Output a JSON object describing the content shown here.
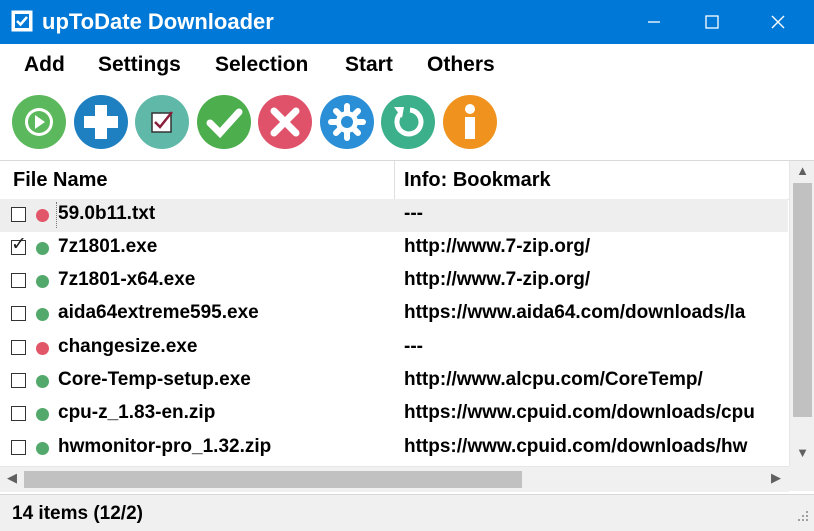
{
  "window": {
    "title": "upToDate Downloader"
  },
  "menu": [
    "Add",
    "Settings",
    "Selection",
    "Start",
    "Others"
  ],
  "toolbar": {
    "buttons": [
      {
        "icon": "play-icon",
        "color": "#5cb85c"
      },
      {
        "icon": "plus-icon",
        "color": "#1e7fc1"
      },
      {
        "icon": "checkbox-icon",
        "color": "#5fb8a8"
      },
      {
        "icon": "checkmark-icon",
        "color": "#4cae4c"
      },
      {
        "icon": "cross-icon",
        "color": "#e0526a"
      },
      {
        "icon": "gear-icon",
        "color": "#2a8fd6"
      },
      {
        "icon": "refresh-icon",
        "color": "#3bb08a"
      },
      {
        "icon": "info-icon",
        "color": "#f0931e"
      }
    ]
  },
  "list": {
    "columns": {
      "name": "File Name",
      "info": "Info: Bookmark"
    },
    "rows": [
      {
        "name": "59.0b11.txt",
        "info": "---",
        "checked": false,
        "status": "red"
      },
      {
        "name": "7z1801.exe",
        "info": "http://www.7-zip.org/",
        "checked": true,
        "status": "green"
      },
      {
        "name": "7z1801-x64.exe",
        "info": "http://www.7-zip.org/",
        "checked": false,
        "status": "green"
      },
      {
        "name": "aida64extreme595.exe",
        "info": "https://www.aida64.com/downloads/la",
        "checked": false,
        "status": "green"
      },
      {
        "name": "changesize.exe",
        "info": "---",
        "checked": false,
        "status": "red"
      },
      {
        "name": "Core-Temp-setup.exe",
        "info": "http://www.alcpu.com/CoreTemp/",
        "checked": false,
        "status": "green"
      },
      {
        "name": "cpu-z_1.83-en.zip",
        "info": "https://www.cpuid.com/downloads/cpu",
        "checked": false,
        "status": "green"
      },
      {
        "name": "hwmonitor-pro_1.32.zip",
        "info": "https://www.cpuid.com/downloads/hw",
        "checked": false,
        "status": "green"
      }
    ]
  },
  "status": {
    "text": "14 items (12/2)"
  }
}
